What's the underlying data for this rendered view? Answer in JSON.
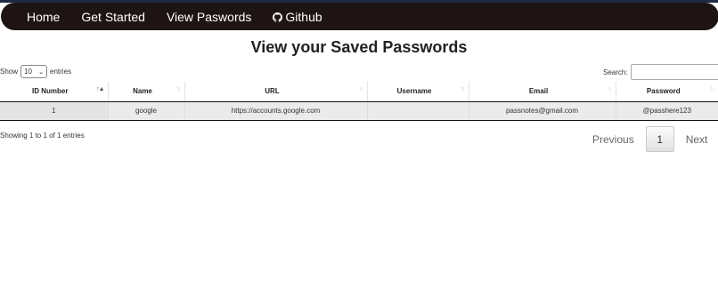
{
  "nav": {
    "items": [
      "Home",
      "Get Started",
      "View Paswords"
    ],
    "github_label": "Github"
  },
  "page": {
    "title": "View your Saved Passwords"
  },
  "controls": {
    "show_label": "Show",
    "entries_value": "10",
    "entries_label": "entries",
    "search_label": "Search:"
  },
  "table": {
    "columns": [
      "ID Number",
      "Name",
      "URL",
      "Username",
      "Email",
      "Password"
    ],
    "sorted_column": "ID Number",
    "rows": [
      [
        "1",
        "google",
        "https://accounts.google.com",
        "",
        "passnotes@gmail.com",
        "@passhere123"
      ]
    ]
  },
  "info": {
    "text": "Showing 1 to 1 of 1 entries"
  },
  "pagination": {
    "previous": "Previous",
    "current": "1",
    "next": "Next"
  },
  "colors": {
    "navbar": "#1f1414",
    "row": "#ebebeb"
  }
}
